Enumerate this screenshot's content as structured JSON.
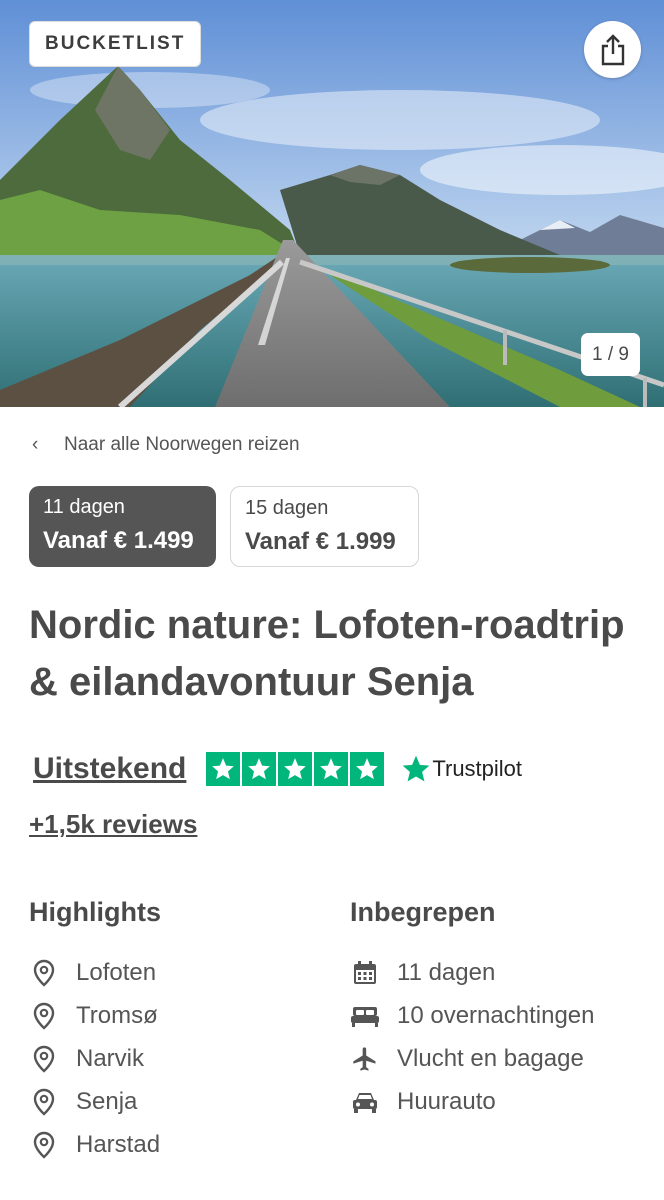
{
  "hero": {
    "badge": "BUCKETLIST",
    "counter": "1 / 9",
    "share_icon": "share-icon"
  },
  "nav": {
    "back_label": "Naar alle Noorwegen reizen"
  },
  "options": [
    {
      "days": "11 dagen",
      "price": "Vanaf € 1.499",
      "selected": true
    },
    {
      "days": "15 dagen",
      "price": "Vanaf € 1.999",
      "selected": false
    }
  ],
  "title": "Nordic nature: Lofoten-roadtrip & eilandavontuur Senja",
  "rating": {
    "label": "Uitstekend",
    "stars": 5,
    "provider": "Trustpilot",
    "reviews": "+1,5k reviews"
  },
  "highlights": {
    "heading": "Highlights",
    "items": [
      "Lofoten",
      "Tromsø",
      "Narvik",
      "Senja",
      "Harstad"
    ]
  },
  "included": {
    "heading": "Inbegrepen",
    "items": [
      {
        "icon": "calendar-icon",
        "label": "11 dagen"
      },
      {
        "icon": "bed-icon",
        "label": "10 overnachtingen"
      },
      {
        "icon": "airplane-icon",
        "label": "Vlucht en bagage"
      },
      {
        "icon": "car-icon",
        "label": "Huurauto"
      }
    ]
  },
  "colors": {
    "active_option": "#555555",
    "trustpilot_green": "#00b67a"
  }
}
